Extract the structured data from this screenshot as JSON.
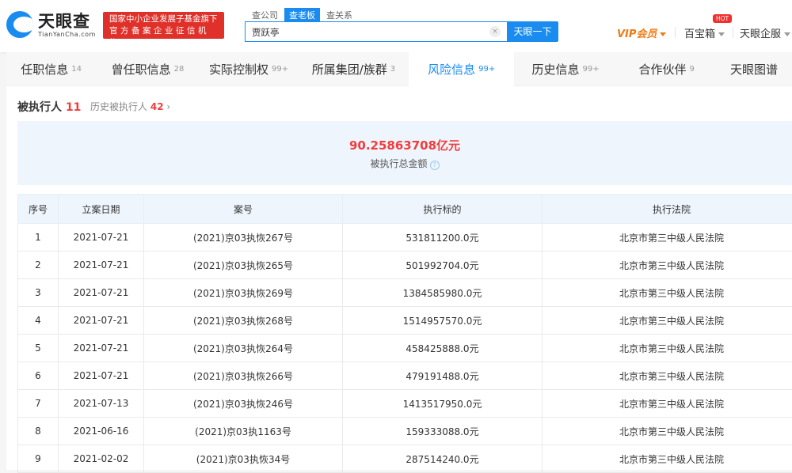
{
  "header": {
    "logo_name": "天眼查",
    "logo_url": "TianYanCha.com",
    "badge_line1": "国家中小企业发展子基金旗下",
    "badge_line2": "官方备案企业征信机构",
    "search_tabs": [
      "查公司",
      "查老板",
      "查关系"
    ],
    "search_value": "贾跃亭",
    "clear": "×",
    "search_button": "天眼一下",
    "vip": "VIP会员",
    "toolbox": "百宝箱",
    "hot": "HOT",
    "service": "天眼企服"
  },
  "tabs": [
    {
      "label": "任职信息",
      "count": "14"
    },
    {
      "label": "曾任职信息",
      "count": "28"
    },
    {
      "label": "实际控制权",
      "count": "99+"
    },
    {
      "label": "所属集团/族群",
      "count": "3"
    },
    {
      "label": "风险信息",
      "count": "99+"
    },
    {
      "label": "历史信息",
      "count": "99+"
    },
    {
      "label": "合作伙伴",
      "count": "9"
    },
    {
      "label": "天眼图谱",
      "count": ""
    }
  ],
  "section": {
    "title": "被执行人",
    "count": "11",
    "history_label": "历史被执行人",
    "history_count": "42",
    "chevron": "›"
  },
  "summary": {
    "amount": "90.25863708亿元",
    "label": "被执行总金额",
    "help": "?"
  },
  "table": {
    "headers": [
      "序号",
      "立案日期",
      "案号",
      "执行标的",
      "执行法院"
    ],
    "rows": [
      [
        "1",
        "2021-07-21",
        "(2021)京03执恢267号",
        "531811200.0元",
        "北京市第三中级人民法院"
      ],
      [
        "2",
        "2021-07-21",
        "(2021)京03执恢265号",
        "501992704.0元",
        "北京市第三中级人民法院"
      ],
      [
        "3",
        "2021-07-21",
        "(2021)京03执恢269号",
        "1384585980.0元",
        "北京市第三中级人民法院"
      ],
      [
        "4",
        "2021-07-21",
        "(2021)京03执恢268号",
        "1514957570.0元",
        "北京市第三中级人民法院"
      ],
      [
        "5",
        "2021-07-21",
        "(2021)京03执恢264号",
        "458425888.0元",
        "北京市第三中级人民法院"
      ],
      [
        "6",
        "2021-07-21",
        "(2021)京03执恢266号",
        "479191488.0元",
        "北京市第三中级人民法院"
      ],
      [
        "7",
        "2021-07-13",
        "(2021)京03执恢246号",
        "1413517950.0元",
        "北京市第三中级人民法院"
      ],
      [
        "8",
        "2021-06-16",
        "(2021)京03执1163号",
        "159333088.0元",
        "北京市第三中级人民法院"
      ],
      [
        "9",
        "2021-02-02",
        "(2021)京03执恢34号",
        "287514240.0元",
        "北京市第三中级人民法院"
      ]
    ]
  }
}
